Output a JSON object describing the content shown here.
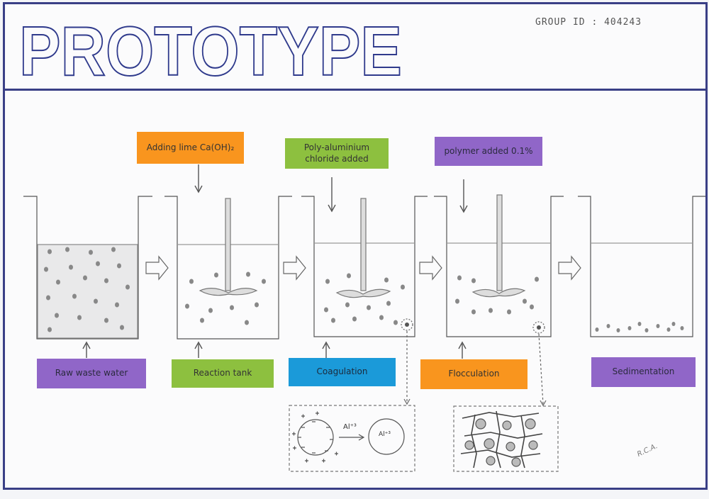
{
  "title": "PROTOTYPE",
  "group_id": "GROUP ID : 404243",
  "additives": {
    "lime": "Adding lime Ca(OH)₂",
    "pac": "Poly-aluminium chloride added",
    "polymer": "polymer added 0.1%"
  },
  "stages": {
    "raw": "Raw waste water",
    "reaction": "Reaction tank",
    "coagulation": "Coagulation",
    "flocculation": "Flocculation",
    "sedimentation": "Sedimentation"
  },
  "coagulation_detail": {
    "ion": "Al⁺³",
    "ion_inside": "Al⁺³"
  },
  "signature": "R.C.A.",
  "colors": {
    "orange": "#f9951e",
    "green": "#8dc03f",
    "purple": "#9066c8",
    "blue": "#1b9ad9",
    "ink": "#3a3f86"
  }
}
